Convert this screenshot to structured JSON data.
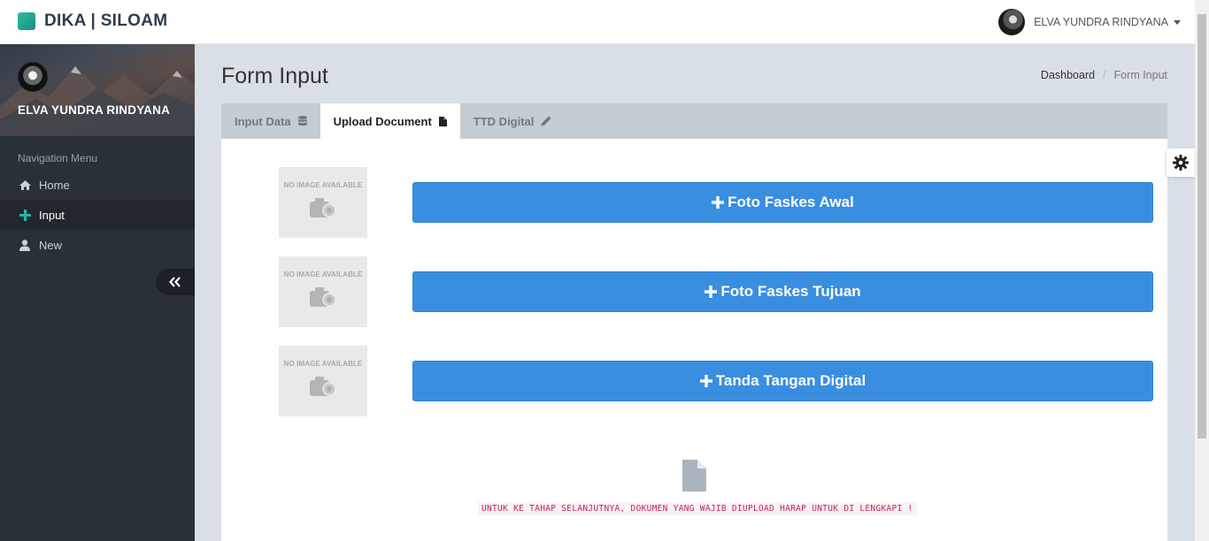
{
  "app": {
    "brand": "DIKA | SILOAM",
    "brand_color": "#26a69a"
  },
  "header": {
    "user_name": "ELVA YUNDRA RINDYANA"
  },
  "sidebar": {
    "profile_name": "ELVA YUNDRA RINDYANA",
    "nav_header": "Navigation Menu",
    "items": [
      {
        "label": "Home",
        "icon": "home-icon"
      },
      {
        "label": "Input",
        "icon": "plus-icon",
        "active": true
      },
      {
        "label": "New",
        "icon": "user-icon"
      }
    ]
  },
  "page": {
    "title": "Form Input",
    "breadcrumb": [
      "Dashboard",
      "Form Input"
    ]
  },
  "tabs": [
    {
      "label": "Input Data",
      "icon": "database-icon"
    },
    {
      "label": "Upload Document",
      "icon": "file-icon",
      "active": true
    },
    {
      "label": "TTD Digital",
      "icon": "pencil-icon"
    }
  ],
  "uploads": [
    {
      "placeholder": "NO IMAGE AVAILABLE",
      "button_label": "Foto Faskes Awal"
    },
    {
      "placeholder": "NO IMAGE AVAILABLE",
      "button_label": "Foto Faskes Tujuan"
    },
    {
      "placeholder": "NO IMAGE AVAILABLE",
      "button_label": "Tanda Tangan Digital"
    }
  ],
  "notice": "UNTUK KE TAHAP SELANJUTNYA, DOKUMEN YANG WAJIB DIUPLOAD HARAP UNTUK DI LENGKAPI !",
  "colors": {
    "primary_button": "#3a8ee0",
    "sidebar_bg": "#2a3038",
    "notice_text": "#c7254e"
  }
}
